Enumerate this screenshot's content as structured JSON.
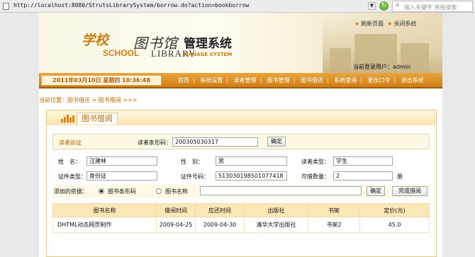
{
  "browser": {
    "url": "http://localhost:8080/StrutsLibrarySystem/borrow.do?action=bookborrow",
    "search_placeholder": "输入关键字 直接搜索"
  },
  "banner": {
    "logo_school_cn": "学校",
    "logo_school_en": "SCHOOL",
    "logo_library_cn": "图书馆",
    "logo_library_en": "LIBRARY",
    "logo_mgmt_cn": "管理系统",
    "logo_mgmt_en": "MANAGE SYSTEM",
    "refresh_label": "刷新页面",
    "close_label": "关闭系统",
    "current_user": "当前登录用户：admin"
  },
  "nav": {
    "date": "2011年03月10日  星期四  10:36:48",
    "items": [
      "首页",
      "系统设置",
      "读者管理",
      "图书管理",
      "图书借还",
      "系统查询",
      "更改口令",
      "退出系统"
    ]
  },
  "breadcrumb": "当前位置：图书借还 > 图书借阅 >>>",
  "panel": {
    "title": "图书借阅"
  },
  "verify": {
    "section_label": "读者验证",
    "barcode_label": "读者条形码：",
    "barcode_value": "200305030317",
    "confirm": "确定"
  },
  "reader": {
    "name_label": "姓　名：",
    "name": "汪建林",
    "gender_label": "性　别：",
    "gender": "男",
    "type_label": "读者类型：",
    "type": "学生",
    "id_type_label": "证件类型：",
    "id_type": "身份证",
    "id_no_label": "证件号码：",
    "id_no": "513030198501077418",
    "max_label": "可借数量：",
    "max": "2",
    "unit": "册"
  },
  "add": {
    "label": "添加的依据：",
    "opt1": "图书条形码",
    "opt2": "图书名称",
    "confirm": "确定",
    "finish": "完成借阅"
  },
  "table": {
    "headers": [
      "图书名称",
      "借阅时间",
      "应还时间",
      "出版社",
      "书架",
      "定价(元)"
    ],
    "rows": [
      [
        "DHTML动态网页制作",
        "2009-04-25",
        "2009-04-30",
        "清华大学出版社",
        "书架2",
        "45.0"
      ]
    ]
  }
}
